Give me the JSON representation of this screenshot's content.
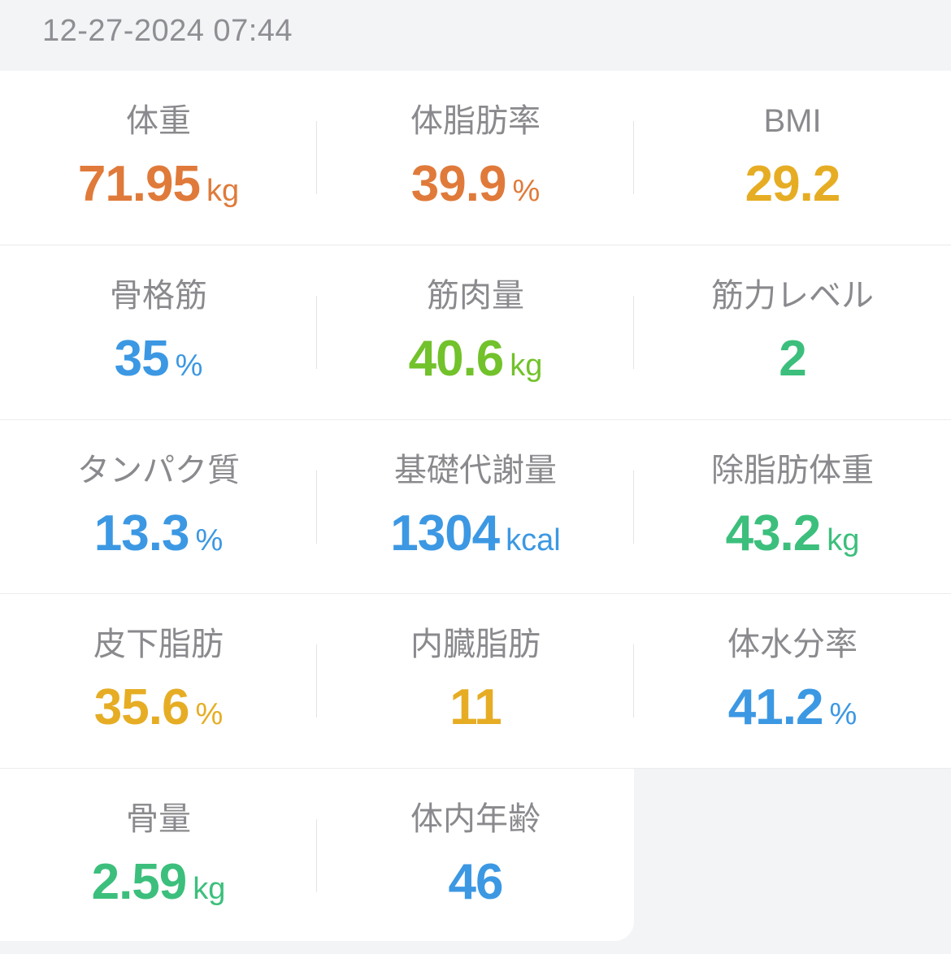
{
  "timestamp": "12-27-2024 07:44",
  "colors": {
    "orange": "#e07a3a",
    "yellow": "#e6ad24",
    "blue": "#3c98e3",
    "lime": "#72c22b",
    "green": "#3cbf7c"
  },
  "metrics": [
    {
      "label": "体重",
      "value": "71.95",
      "unit": "kg",
      "color": "#e07a3a"
    },
    {
      "label": "体脂肪率",
      "value": "39.9",
      "unit": "%",
      "color": "#e07a3a"
    },
    {
      "label": "BMI",
      "value": "29.2",
      "unit": "",
      "color": "#e6ad24"
    },
    {
      "label": "骨格筋",
      "value": "35",
      "unit": "%",
      "color": "#3c98e3"
    },
    {
      "label": "筋肉量",
      "value": "40.6",
      "unit": "kg",
      "color": "#72c22b"
    },
    {
      "label": "筋力レベル",
      "value": "2",
      "unit": "",
      "color": "#3cbf7c"
    },
    {
      "label": "タンパク質",
      "value": "13.3",
      "unit": "%",
      "color": "#3c98e3"
    },
    {
      "label": "基礎代謝量",
      "value": "1304",
      "unit": "kcal",
      "color": "#3c98e3"
    },
    {
      "label": "除脂肪体重",
      "value": "43.2",
      "unit": "kg",
      "color": "#3cbf7c"
    },
    {
      "label": "皮下脂肪",
      "value": "35.6",
      "unit": "%",
      "color": "#e6ad24"
    },
    {
      "label": "内臓脂肪",
      "value": "11",
      "unit": "",
      "color": "#e6ad24"
    },
    {
      "label": "体水分率",
      "value": "41.2",
      "unit": "%",
      "color": "#3c98e3"
    },
    {
      "label": "骨量",
      "value": "2.59",
      "unit": "kg",
      "color": "#3cbf7c"
    },
    {
      "label": "体内年齢",
      "value": "46",
      "unit": "",
      "color": "#3c98e3"
    }
  ]
}
